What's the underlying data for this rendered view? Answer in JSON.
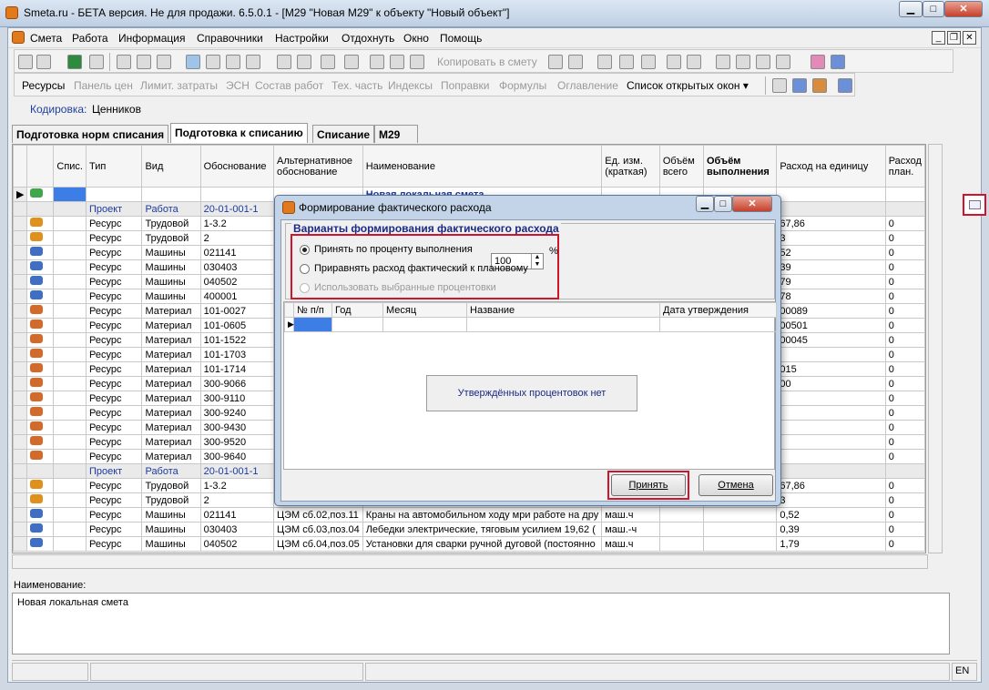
{
  "window": {
    "title": "Smeta.ru - БЕТА версия. Не для продажи.  6.5.0.1   - [M29 \"Новая М29\" к объекту \"Новый объект\"]"
  },
  "menu": [
    "Смета",
    "Работа",
    "Информация",
    "Справочники",
    "Настройки",
    "Отдохнуть",
    "Окно",
    "Помощь"
  ],
  "toolbar2": {
    "copy_to_smeta": "Копировать в смету",
    "items": [
      "Ресурсы",
      "Панель цен",
      "Лимит. затраты",
      "ЭСН",
      "Состав работ",
      "Тех. часть",
      "Индексы",
      "Поправки",
      "Формулы",
      "Оглавление"
    ],
    "open_windows": "Список открытых окон"
  },
  "encoding": {
    "label": "Кодировка:",
    "value": "Ценников"
  },
  "tabs": [
    "Подготовка норм списания",
    "Подготовка к списанию",
    "Списание",
    "M29"
  ],
  "grid": {
    "headers": {
      "spis": "Спис.",
      "type": "Тип",
      "kind": "Вид",
      "basis": "Обоснование",
      "alt_basis": "Альтернативное обоснование",
      "name": "Наименование",
      "unit": "Ед. изм. (краткая)",
      "vol_total": "Объём всего",
      "vol_done": "Объём выполнения",
      "per_unit": "Расход на единицу",
      "plan": "Расход план."
    },
    "first_row_name": "Новая локальная смета",
    "rows": [
      {
        "type": "Проект",
        "kind": "Работа",
        "basis": "20-01-001-1",
        "alt": "",
        "name": "",
        "unit": "",
        "per": "",
        "plan": ""
      },
      {
        "type": "Ресурс",
        "kind": "Трудовой",
        "basis": "1-3.2",
        "alt": "",
        "name": "",
        "unit": "",
        "per": "67,86",
        "plan": "0"
      },
      {
        "type": "Ресурс",
        "kind": "Трудовой",
        "basis": "2",
        "alt": "",
        "name": "",
        "unit": "",
        "per": "3",
        "plan": "0"
      },
      {
        "type": "Ресурс",
        "kind": "Машины",
        "basis": "021141",
        "alt": "",
        "name": "",
        "unit": "",
        "per": "52",
        "plan": "0"
      },
      {
        "type": "Ресурс",
        "kind": "Машины",
        "basis": "030403",
        "alt": "",
        "name": "",
        "unit": "",
        "per": "39",
        "plan": "0"
      },
      {
        "type": "Ресурс",
        "kind": "Машины",
        "basis": "040502",
        "alt": "",
        "name": "",
        "unit": "",
        "per": "79",
        "plan": "0"
      },
      {
        "type": "Ресурс",
        "kind": "Машины",
        "basis": "400001",
        "alt": "",
        "name": "",
        "unit": "",
        "per": "78",
        "plan": "0"
      },
      {
        "type": "Ресурс",
        "kind": "Материал",
        "basis": "101-0027",
        "alt": "",
        "name": "",
        "unit": "",
        "per": "00089",
        "plan": "0"
      },
      {
        "type": "Ресурс",
        "kind": "Материал",
        "basis": "101-0605",
        "alt": "",
        "name": "",
        "unit": "",
        "per": "00501",
        "plan": "0"
      },
      {
        "type": "Ресурс",
        "kind": "Материал",
        "basis": "101-1522",
        "alt": "",
        "name": "",
        "unit": "",
        "per": "00045",
        "plan": "0"
      },
      {
        "type": "Ресурс",
        "kind": "Материал",
        "basis": "101-1703",
        "alt": "",
        "name": "",
        "unit": "",
        "per": "",
        "plan": "0"
      },
      {
        "type": "Ресурс",
        "kind": "Материал",
        "basis": "101-1714",
        "alt": "",
        "name": "",
        "unit": "",
        "per": "015",
        "plan": "0"
      },
      {
        "type": "Ресурс",
        "kind": "Материал",
        "basis": "300-9066",
        "alt": "",
        "name": "",
        "unit": "",
        "per": "00",
        "plan": "0"
      },
      {
        "type": "Ресурс",
        "kind": "Материал",
        "basis": "300-9110",
        "alt": "",
        "name": "",
        "unit": "",
        "per": "",
        "plan": "0"
      },
      {
        "type": "Ресурс",
        "kind": "Материал",
        "basis": "300-9240",
        "alt": "",
        "name": "",
        "unit": "",
        "per": "",
        "plan": "0"
      },
      {
        "type": "Ресурс",
        "kind": "Материал",
        "basis": "300-9430",
        "alt": "",
        "name": "",
        "unit": "",
        "per": "",
        "plan": "0"
      },
      {
        "type": "Ресурс",
        "kind": "Материал",
        "basis": "300-9520",
        "alt": "",
        "name": "",
        "unit": "",
        "per": "",
        "plan": "0"
      },
      {
        "type": "Ресурс",
        "kind": "Материал",
        "basis": "300-9640",
        "alt": "",
        "name": "",
        "unit": "",
        "per": "",
        "plan": "0"
      },
      {
        "type": "Проект",
        "kind": "Работа",
        "basis": "20-01-001-1",
        "alt": "",
        "name": "",
        "unit": "",
        "per": "",
        "plan": ""
      },
      {
        "type": "Ресурс",
        "kind": "Трудовой",
        "basis": "1-3.2",
        "alt": "",
        "name": "",
        "unit": "",
        "per": "67,86",
        "plan": "0"
      },
      {
        "type": "Ресурс",
        "kind": "Трудовой",
        "basis": "2",
        "alt": "",
        "name": "",
        "unit": "",
        "per": "3",
        "plan": "0"
      },
      {
        "type": "Ресурс",
        "kind": "Машины",
        "basis": "021141",
        "alt": "ЦЭМ  сб.02,поз.11",
        "name": "Краны на автомобильном ходу мри работе на дру",
        "unit": "маш.ч",
        "per": "0,52",
        "plan": "0"
      },
      {
        "type": "Ресурс",
        "kind": "Машины",
        "basis": "030403",
        "alt": "ЦЭМ  сб.03,поз.04",
        "name": "Лебедки электрические, тяговым усилием 19,62 (",
        "unit": "маш.-ч",
        "per": "0,39",
        "plan": "0"
      },
      {
        "type": "Ресурс",
        "kind": "Машины",
        "basis": "040502",
        "alt": "ЦЭМ  сб.04,поз.05",
        "name": "Установки для сварки ручной дуговой (постоянно",
        "unit": "маш.ч",
        "per": "1,79",
        "plan": "0"
      }
    ]
  },
  "name_panel": {
    "label": "Наименование:",
    "value": "Новая локальная смета"
  },
  "status": {
    "lang": "EN"
  },
  "dialog": {
    "title": "Формирование фактического расхода",
    "group_title": "Варианты формирования фактического расхода",
    "option1": "Принять по проценту выполнения",
    "percent_value": "100",
    "percent_sign": "%",
    "option2": "Приравнять расход фактический к плановому",
    "option3": "Использовать выбранные процентовки",
    "table_headers": [
      "№ п/п",
      "Год",
      "Месяц",
      "Название",
      "Дата утверждения"
    ],
    "empty_text": "Утверждённых процентовок нет",
    "ok": "Принять",
    "cancel": "Отмена"
  },
  "colors": {
    "highlight_red": "#d0142c",
    "link_blue": "#1c3aa0"
  }
}
